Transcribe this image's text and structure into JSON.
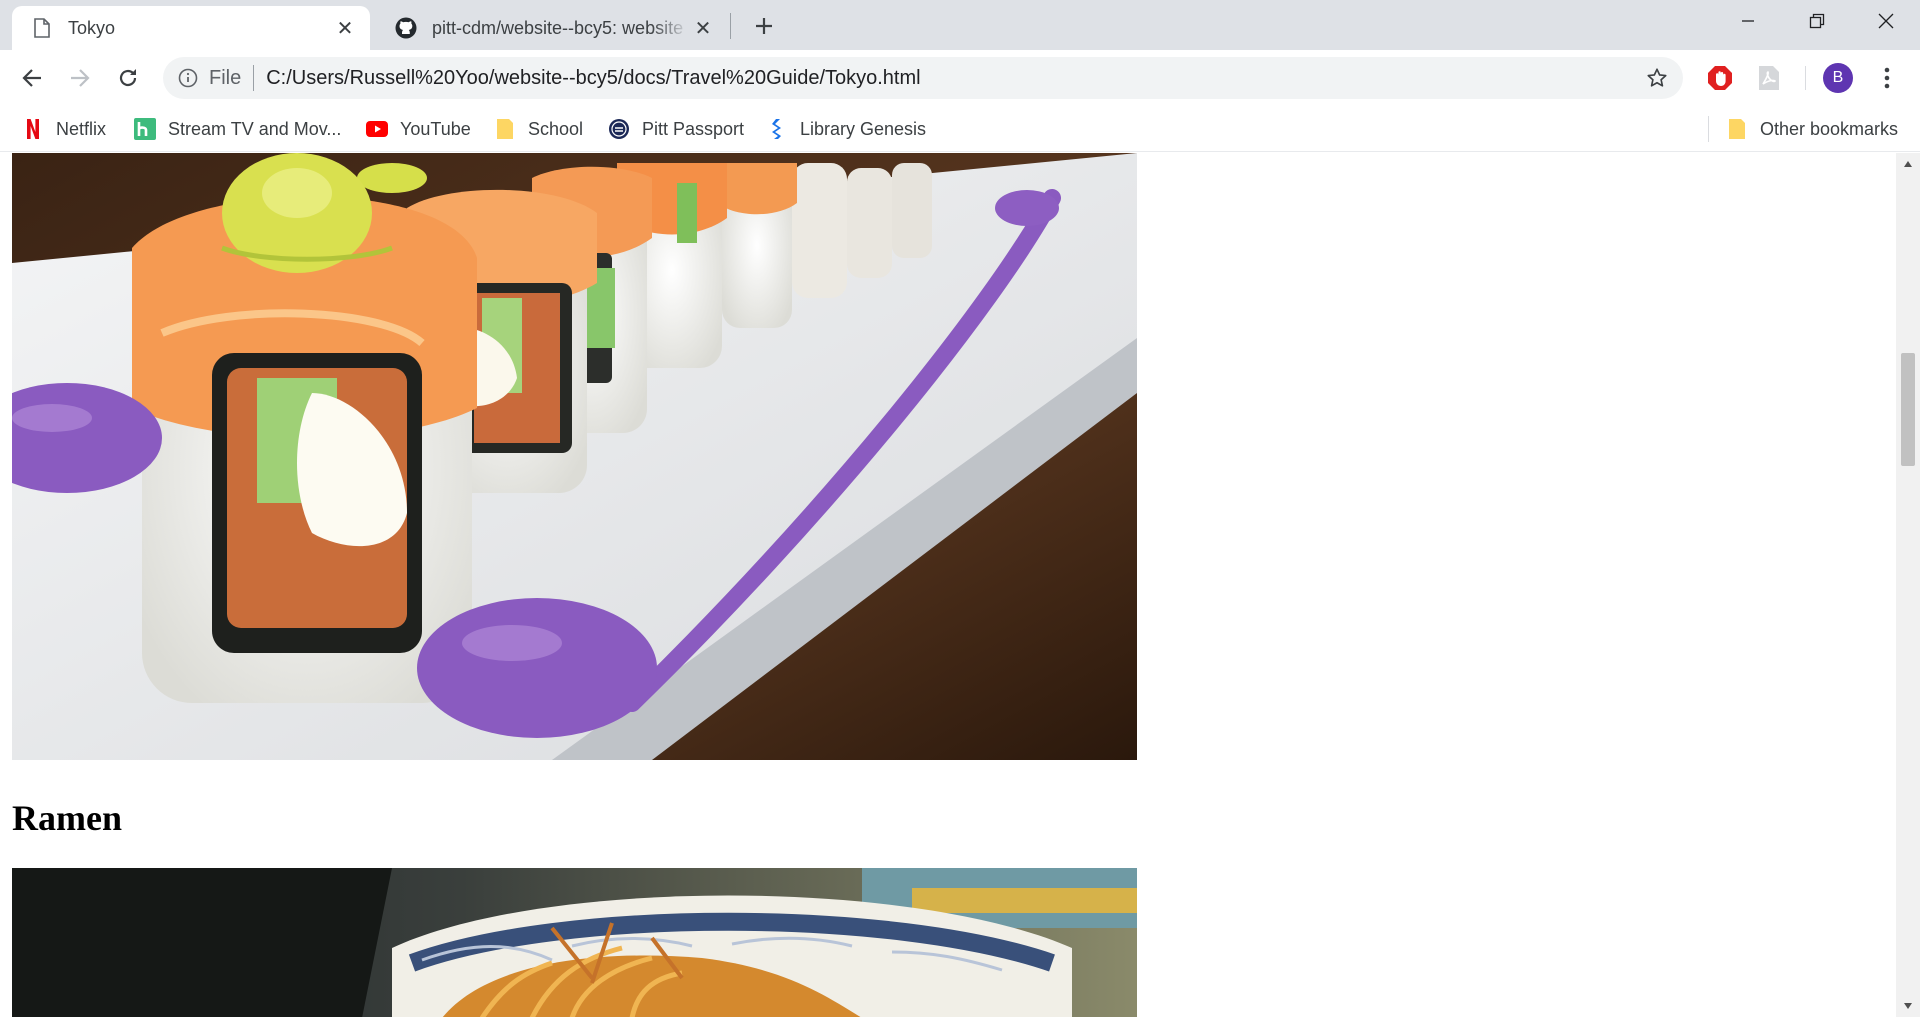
{
  "tabs": [
    {
      "title": "Tokyo",
      "icon": "document-icon",
      "active": true
    },
    {
      "title": "pitt-cdm/website--bcy5: website",
      "icon": "github-icon",
      "active": false
    }
  ],
  "toolbar": {
    "security_label": "File",
    "url": "C:/Users/Russell%20Yoo/website--bcy5/docs/Travel%20Guide/Tokyo.html",
    "profile_initial": "B"
  },
  "bookmarks": [
    {
      "label": "Netflix",
      "icon": "netflix-icon"
    },
    {
      "label": "Stream TV and Mov...",
      "icon": "hulu-icon"
    },
    {
      "label": "YouTube",
      "icon": "youtube-icon"
    },
    {
      "label": "School",
      "icon": "folder-icon"
    },
    {
      "label": "Pitt Passport",
      "icon": "pitt-icon"
    },
    {
      "label": "Library Genesis",
      "icon": "library-icon"
    }
  ],
  "other_bookmarks": {
    "label": "Other bookmarks",
    "icon": "folder-icon"
  },
  "page": {
    "heading": "Ramen",
    "images": [
      "sushi-rolls-photo",
      "ramen-bowl-photo"
    ]
  },
  "colors": {
    "tabstrip": "#dee1e6",
    "omnibox": "#f1f3f4",
    "avatar": "#5e35b1",
    "sauce": "#8a5bc0"
  }
}
